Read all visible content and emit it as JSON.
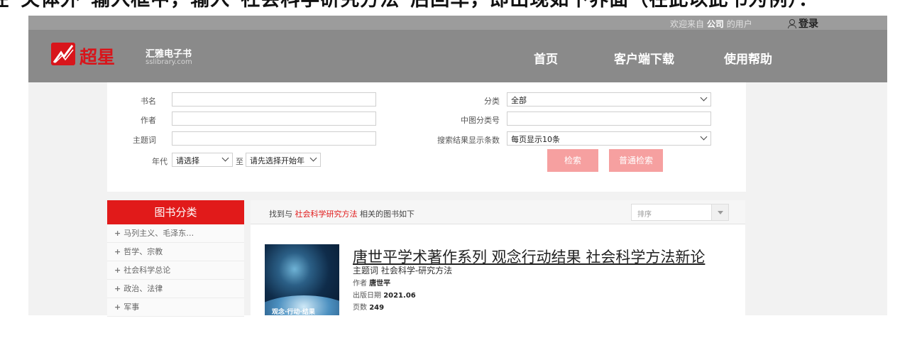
{
  "top_strip": {
    "text": "在\"关体外\"输入框中，输入\"社会科学研究方法\"后回车，即出现如下界面（在此以此书为例）："
  },
  "topbar": {
    "welcome_prefix": "欢迎来自",
    "company": "公司",
    "welcome_suffix": "的用户",
    "login": "登录"
  },
  "header": {
    "logo_text": "超星",
    "brand": "汇雅电子书",
    "brand_sub": "sslibrary.com",
    "nav": [
      "首页",
      "客户端下载",
      "使用帮助"
    ]
  },
  "search": {
    "labels": {
      "title": "书名",
      "author": "作者",
      "subject": "主题词",
      "era": "年代",
      "to": "至",
      "category": "分类",
      "clc": "中图分类号",
      "per_page": "搜索结果显示条数"
    },
    "values": {
      "title": "",
      "author": "",
      "subject": "",
      "era_from": "请选择",
      "era_to": "请先选择开始年",
      "category": "全部",
      "clc": "",
      "per_page": "每页显示10条"
    },
    "buttons": {
      "search": "检索",
      "normal_search": "普通检索"
    }
  },
  "categories": {
    "header": "图书分类",
    "items": [
      "马列主义、毛泽东…",
      "哲学、宗教",
      "社会科学总论",
      "政治、法律",
      "军事"
    ]
  },
  "results": {
    "prefix": "找到与",
    "keyword": "社会科学研究方法",
    "suffix": "相关的图书如下",
    "sort_placeholder": "排序",
    "book": {
      "title": "唐世平学术著作系列 观念行动结果 社会科学方法新论",
      "subject_label": "主题词",
      "subject": "社会科学-研究方法",
      "author_label": "作者",
      "author": "唐世平",
      "date_label": "出版日期",
      "date": "2021.06",
      "pages_label": "页数",
      "pages": "249",
      "cover_text": "观念·行动·结果"
    }
  },
  "colors": {
    "accent_red": "#e11a1a",
    "button_pink": "#f6a0a0",
    "header_gray": "#8a8a8a"
  },
  "icons": [
    "user-icon",
    "logo-icon",
    "plus-icon",
    "chevron-down-icon"
  ]
}
